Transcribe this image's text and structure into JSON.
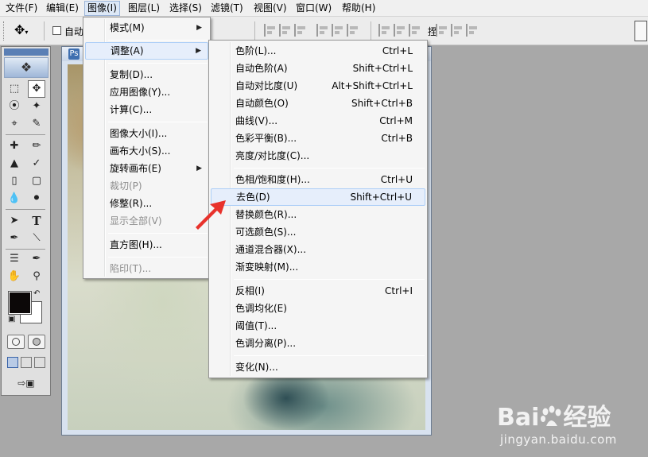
{
  "menubar": {
    "items": [
      "文件(F)",
      "编辑(E)",
      "图像(I)",
      "图层(L)",
      "选择(S)",
      "滤镜(T)",
      "视图(V)",
      "窗口(W)",
      "帮助(H)"
    ],
    "active_index": 2
  },
  "options_bar": {
    "auto_select_label": "自动",
    "cut_text": "挃"
  },
  "toolbox": {
    "colors": {
      "foreground": "#0c0808",
      "background": "#ffffff"
    }
  },
  "image_menu": {
    "items": [
      {
        "label": "模式(M)",
        "submenu": true
      },
      {
        "label": "调整(A)",
        "submenu": true,
        "highlighted": true
      },
      {
        "label": "复制(D)..."
      },
      {
        "label": "应用图像(Y)..."
      },
      {
        "label": "计算(C)..."
      },
      {
        "label": "图像大小(I)..."
      },
      {
        "label": "画布大小(S)..."
      },
      {
        "label": "旋转画布(E)",
        "submenu": true
      },
      {
        "label": "裁切(P)",
        "disabled": true
      },
      {
        "label": "修整(R)..."
      },
      {
        "label": "显示全部(V)",
        "disabled": true
      },
      {
        "label": "直方图(H)..."
      },
      {
        "label": "陷印(T)...",
        "disabled": true
      }
    ]
  },
  "adjust_menu": {
    "items": [
      {
        "label": "色阶(L)...",
        "shortcut": "Ctrl+L"
      },
      {
        "label": "自动色阶(A)",
        "shortcut": "Shift+Ctrl+L"
      },
      {
        "label": "自动对比度(U)",
        "shortcut": "Alt+Shift+Ctrl+L"
      },
      {
        "label": "自动颜色(O)",
        "shortcut": "Shift+Ctrl+B"
      },
      {
        "label": "曲线(V)...",
        "shortcut": "Ctrl+M"
      },
      {
        "label": "色彩平衡(B)...",
        "shortcut": "Ctrl+B"
      },
      {
        "label": "亮度/对比度(C)...",
        "shortcut": ""
      },
      {
        "label": "色相/饱和度(H)...",
        "shortcut": "Ctrl+U"
      },
      {
        "label": "去色(D)",
        "shortcut": "Shift+Ctrl+U",
        "highlighted": true
      },
      {
        "label": "替换颜色(R)...",
        "shortcut": ""
      },
      {
        "label": "可选颜色(S)...",
        "shortcut": ""
      },
      {
        "label": "通道混合器(X)...",
        "shortcut": ""
      },
      {
        "label": "渐变映射(M)...",
        "shortcut": ""
      },
      {
        "label": "反相(I)",
        "shortcut": "Ctrl+I"
      },
      {
        "label": "色调均化(E)",
        "shortcut": ""
      },
      {
        "label": "阈值(T)...",
        "shortcut": ""
      },
      {
        "label": "色调分离(P)...",
        "shortcut": ""
      },
      {
        "label": "变化(N)...",
        "shortcut": ""
      }
    ]
  },
  "annotation": {
    "arrow_color": "#e8322c"
  },
  "watermark": {
    "brand": "Bai",
    "brand_suffix": "经验",
    "url": "jingyan.baidu.com"
  }
}
